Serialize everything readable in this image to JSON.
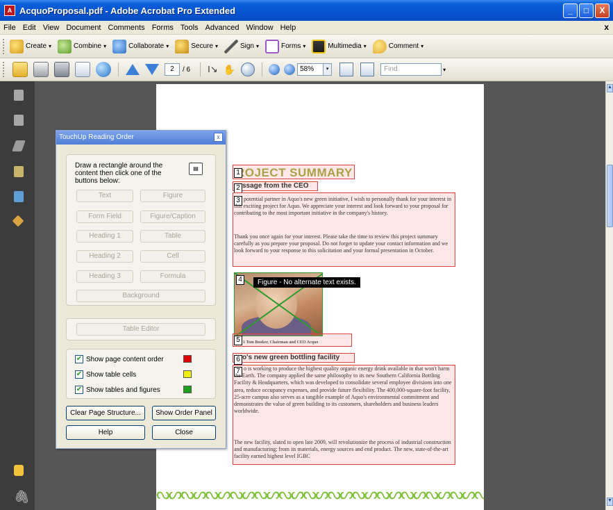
{
  "window": {
    "title": "AcquoProposal.pdf - Adobe Acrobat Pro Extended",
    "app_icon": "acrobat-icon",
    "minimize": "_",
    "maximize": "□",
    "close": "X"
  },
  "menu": {
    "items": [
      "File",
      "Edit",
      "View",
      "Document",
      "Comments",
      "Forms",
      "Tools",
      "Advanced",
      "Window",
      "Help"
    ],
    "close": "x"
  },
  "task_toolbar": {
    "create": "Create",
    "combine": "Combine",
    "collaborate": "Collaborate",
    "secure": "Secure",
    "sign": "Sign",
    "forms": "Forms",
    "multimedia": "Multimedia",
    "comment": "Comment",
    "caret": "▾"
  },
  "nav_toolbar": {
    "current_page": "2",
    "total_pages": "/ 6",
    "zoom": "58%",
    "find_placeholder": "Find",
    "caret": "▾"
  },
  "doc": {
    "heading": "ROJECT SUMMARY",
    "subheading_ceo": "ssage from the CEO",
    "para1": "potential partner in Aquo's new green initiative, I wish to personally thank for your interest in this exciting project for Aquo. We appreciate your interest and look forward to your proposal for contributing to the most important initiative in the company's history.",
    "para2": "Thank you once again for your interest. Please take the time to review this project summary carefully as you prepare your proposal. Do not forget to update your contact information and we look forward to your response to this solicitation and your formal presentation in October.",
    "figure_tooltip": "Figure - No alternate text exists.",
    "caption": "gure 1 Tom Booker, Chairman and CEO Acquo",
    "subheading_facility": "o's new green bottling facility",
    "para3": "o is working to produce the highest quality organic energy drink available in that won't harm the Earth. The company applied the same philosophy to its new Southern California Bottling Facility & Headquarters, which was developed to consolidate several employee divisions into one area, reduce occupancy expenses, and provide future flexibility. The 400,000-square-foot facility, 25-acre campus also serves as a tangible example of Aquo's environmental commitment and demonstrates the value of green building to its customers, shareholders and business leaders worldwide.",
    "para4": "The new facility, slated to open late 2009, will revolutionize the process of industrial construction and manufacturing; from its materials, energy sources and end product. The new, state-of-the-art facility earned highest level IGBC",
    "order_numbers": [
      "1",
      "2",
      "3",
      "4",
      "5",
      "6",
      "7"
    ],
    "footer_decoration": "ᔓᔕᔓᔕᔓᔕᔓᔕᔓᔕᔓᔕᔓᔕᔓᔕᔓᔕᔓᔕᔓᔕᔓᔕᔓᔕᔓᔕᔓᔕ"
  },
  "dialog": {
    "title": "TouchUp Reading Order",
    "close": "x",
    "instructions": "Draw a rectangle around the content then click one of the buttons below:",
    "buttons": {
      "text": "Text",
      "figure": "Figure",
      "form_field": "Form Field",
      "figure_caption": "Figure/Caption",
      "heading1": "Heading 1",
      "table": "Table",
      "heading2": "Heading 2",
      "cell": "Cell",
      "heading3": "Heading 3",
      "formula": "Formula",
      "background": "Background",
      "table_editor": "Table Editor",
      "clear_structure": "Clear Page Structure...",
      "show_order_panel": "Show Order Panel",
      "help": "Help",
      "close": "Close"
    },
    "checkboxes": {
      "show_page_content_order": "Show page content order",
      "show_table_cells": "Show table cells",
      "show_tables_and_figures": "Show tables and figures"
    },
    "colors": {
      "order": "#e00000",
      "cells": "#f2f200",
      "figures": "#1ea01e"
    }
  }
}
